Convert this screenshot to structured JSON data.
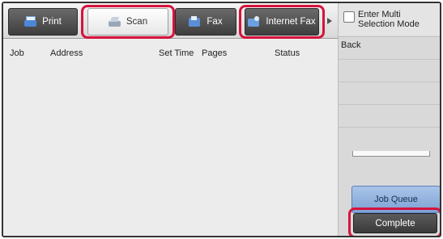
{
  "tabs": [
    {
      "label": "Print",
      "icon": "printer-icon"
    },
    {
      "label": "Scan",
      "icon": "scanner-icon"
    },
    {
      "label": "Fax",
      "icon": "fax-icon"
    },
    {
      "label": "Internet Fax",
      "icon": "internet-fax-icon"
    }
  ],
  "active_tab": "Scan",
  "highlight_color": "#d6123c",
  "columns": [
    "Job",
    "Address",
    "Set Time",
    "Pages",
    "Status"
  ],
  "side": {
    "multi_select_label_line1": "Enter Multi",
    "multi_select_label_line2": "Selection Mode",
    "back_label": "Back",
    "job_queue_label": "Job Queue",
    "complete_label": "Complete"
  }
}
